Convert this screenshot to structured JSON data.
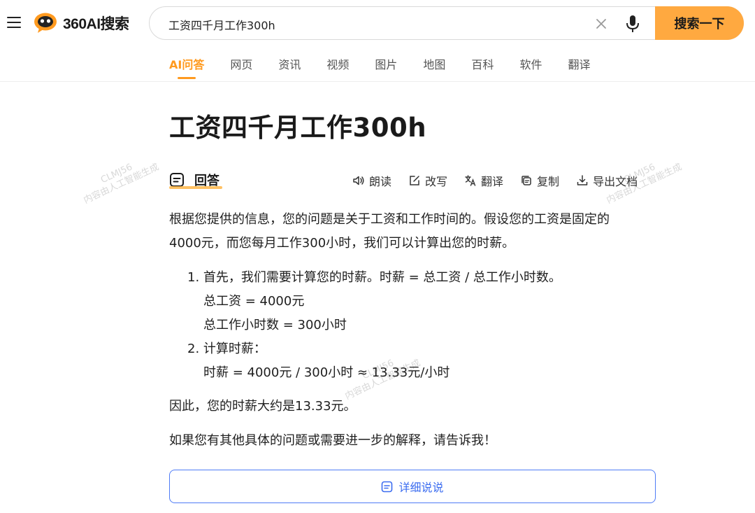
{
  "header": {
    "logo_text": "360AI搜索",
    "search_value": "工资四千月工作300h",
    "search_button": "搜索一下"
  },
  "tabs": [
    {
      "label": "AI问答",
      "active": true
    },
    {
      "label": "网页"
    },
    {
      "label": "资讯"
    },
    {
      "label": "视频"
    },
    {
      "label": "图片"
    },
    {
      "label": "地图"
    },
    {
      "label": "百科"
    },
    {
      "label": "软件"
    },
    {
      "label": "翻译"
    }
  ],
  "content": {
    "title": "工资四千月工作300h",
    "answer_label": "回答",
    "actions": {
      "read": "朗读",
      "rewrite": "改写",
      "translate": "翻译",
      "copy": "复制",
      "export": "导出文档"
    },
    "intro_line1": "根据您提供的信息，您的问题是关于工资和工作时间的。假设您的工资是固定的",
    "intro_line2": "4000元，而您每月工作300小时，我们可以计算出您的时薪。",
    "list": {
      "item1": "1. 首先，我们需要计算您的时薪。时薪 = 总工资 / 总工作小时数。",
      "item1_sub1": "总工资 = 4000元",
      "item1_sub2": "总工作小时数 = 300小时",
      "item2": "2. 计算时薪：",
      "item2_sub1": "时薪 = 4000元 / 300小时 ≈ 13.33元/小时"
    },
    "conclusion": "因此，您的时薪大约是13.33元。",
    "closing": "如果您有其他具体的问题或需要进一步的解释，请告诉我！",
    "detail_button": "详细说说"
  },
  "watermark": {
    "line1": "CLMJ56",
    "line2": "内容由人工智能生成"
  },
  "colors": {
    "accent": "#ff9a1f",
    "search_button": "#ffa940",
    "link_blue": "#3b6cf0"
  }
}
